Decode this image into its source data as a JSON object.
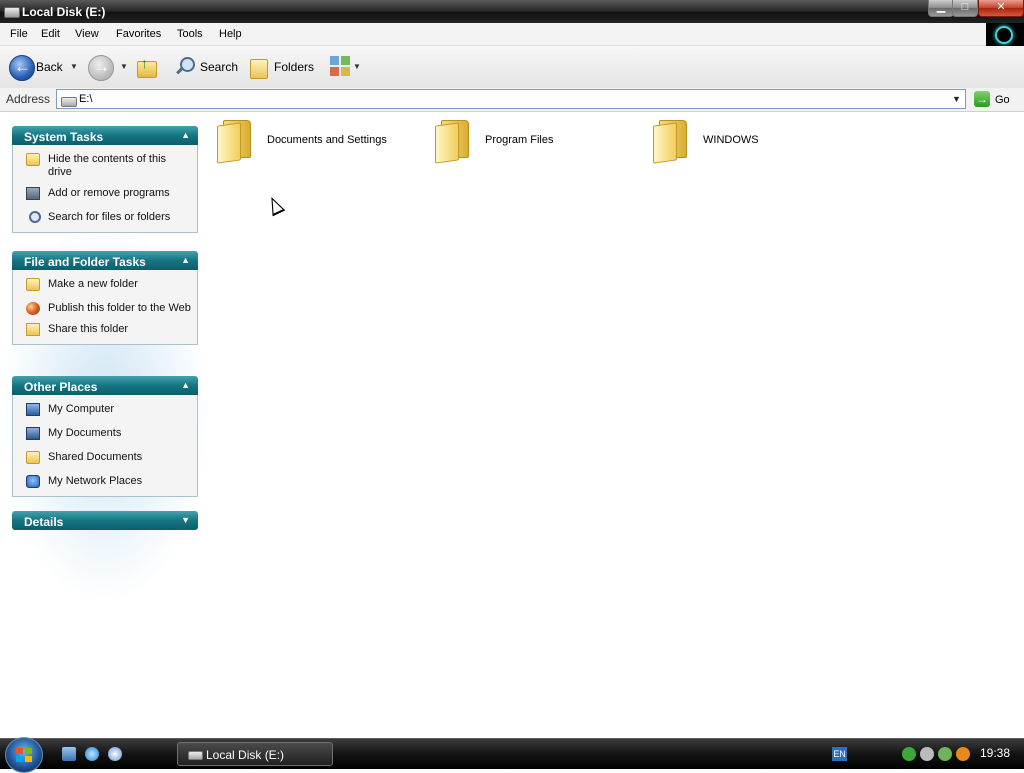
{
  "window": {
    "title": "Local Disk (E:)",
    "min_glyph": "▁",
    "max_glyph": "□",
    "close_glyph": "✕"
  },
  "menu": [
    "File",
    "Edit",
    "View",
    "Favorites",
    "Tools",
    "Help"
  ],
  "toolbar": {
    "back_label": "Back",
    "search_label": "Search",
    "folders_label": "Folders"
  },
  "address": {
    "label": "Address",
    "value": "E:\\",
    "go_label": "Go"
  },
  "task_panels": {
    "system": {
      "title": "System Tasks",
      "items": [
        "Hide the contents of this drive",
        "Add or remove programs",
        "Search for files or folders"
      ]
    },
    "file_folder": {
      "title": "File and Folder Tasks",
      "items": [
        "Make a new folder",
        "Publish this folder to the Web",
        "Share this folder"
      ]
    },
    "other_places": {
      "title": "Other Places",
      "items": [
        "My Computer",
        "My Documents",
        "Shared Documents",
        "My Network Places"
      ]
    },
    "details": {
      "title": "Details"
    }
  },
  "folders": [
    "Documents and Settings",
    "Program Files",
    "WINDOWS"
  ],
  "taskbar": {
    "task_label": "Local Disk (E:)",
    "lang": "EN",
    "clock": "19:38"
  },
  "colors": {
    "panel_header": "#157582",
    "folder_yellow": "#f0cf5a",
    "taskbar": "#141414"
  }
}
